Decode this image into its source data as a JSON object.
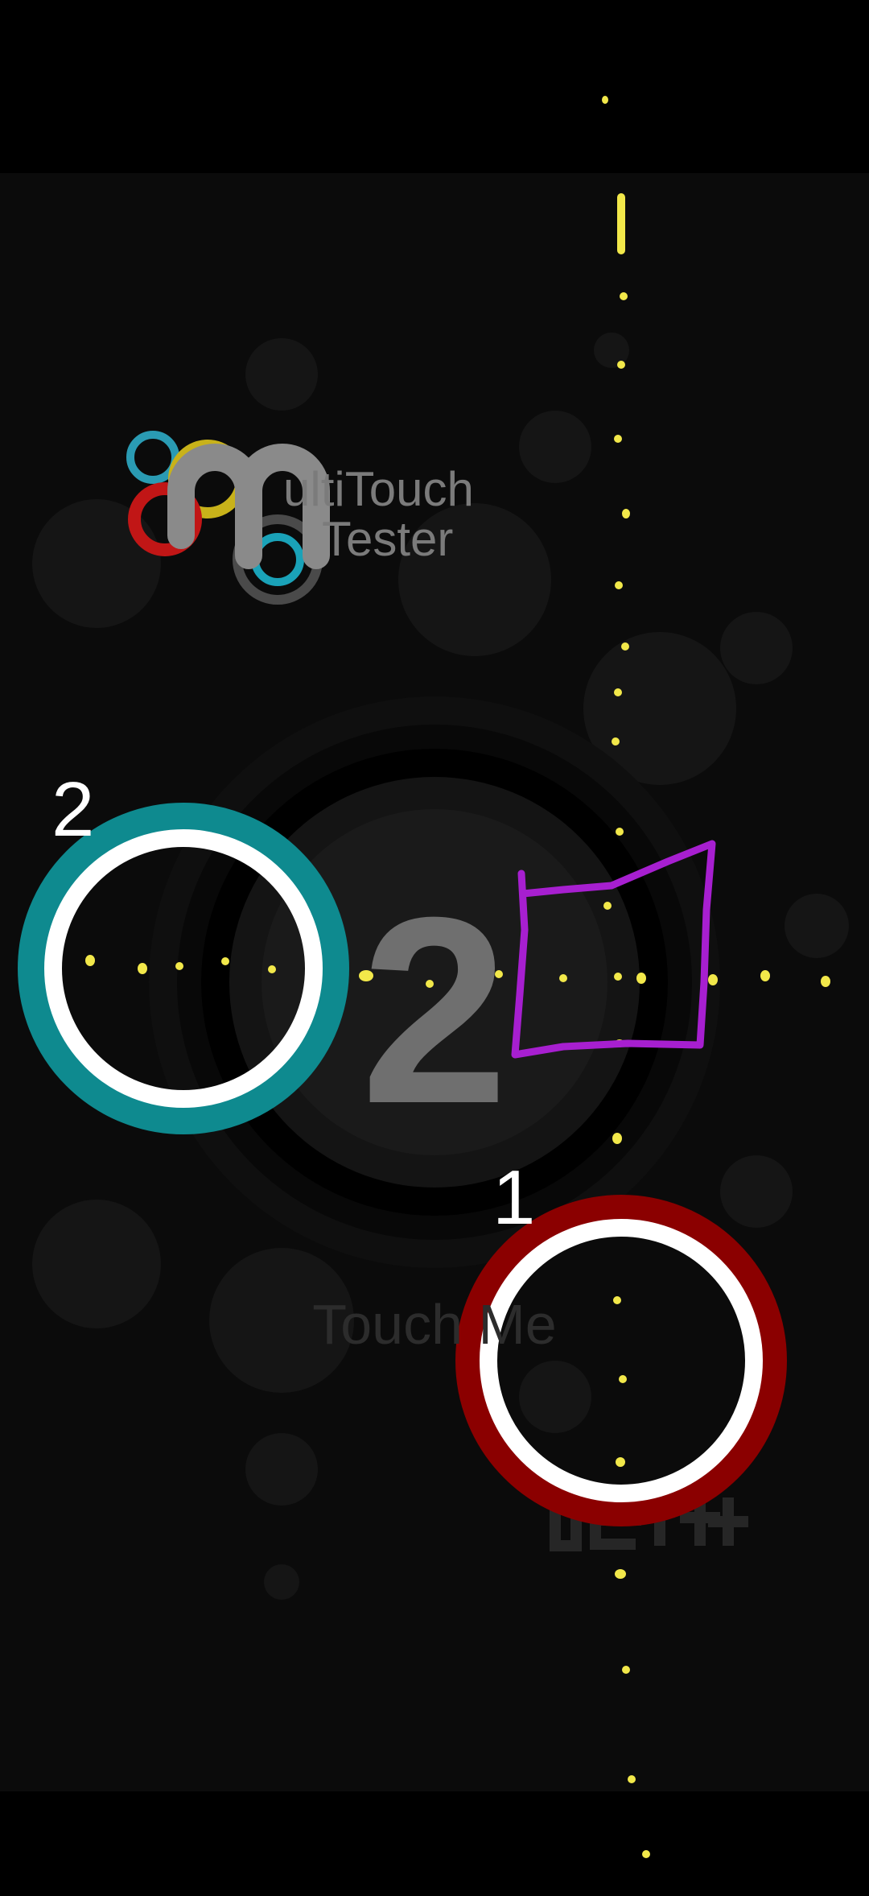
{
  "app": {
    "logo_line1": "ultiTouch",
    "logo_line2": "Tester",
    "touch_count": "2",
    "touch_me_label": "Touch Me"
  },
  "touches": [
    {
      "label": "1",
      "ring_color": "#8b0000"
    },
    {
      "label": "2",
      "ring_color": "#0e8a8f"
    }
  ],
  "colors": {
    "background": "#0b0b0b",
    "status_bar": "#000000",
    "trail_dot": "#f2e84a",
    "drawing_stroke": "#a71fd0",
    "inner_ring": "#ffffff",
    "count_text": "#6f6f6f"
  }
}
